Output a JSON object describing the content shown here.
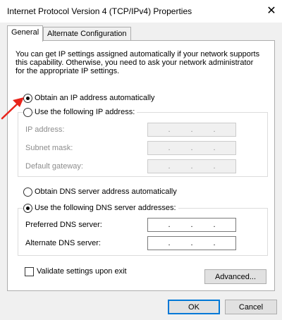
{
  "window": {
    "title": "Internet Protocol Version 4 (TCP/IPv4) Properties",
    "close_glyph": "✕"
  },
  "tabs": [
    {
      "label": "General",
      "active": true
    },
    {
      "label": "Alternate Configuration",
      "active": false
    }
  ],
  "description": "You can get IP settings assigned automatically if your network supports this capability. Otherwise, you need to ask your network administrator for the appropriate IP settings.",
  "ip_section": {
    "auto_label": "Obtain an IP address automatically",
    "auto_selected": true,
    "manual_label": "Use the following IP address:",
    "manual_selected": false,
    "fields": [
      {
        "label": "IP address:",
        "value": "",
        "enabled": false
      },
      {
        "label": "Subnet mask:",
        "value": "",
        "enabled": false
      },
      {
        "label": "Default gateway:",
        "value": "",
        "enabled": false
      }
    ]
  },
  "dns_section": {
    "auto_label": "Obtain DNS server address automatically",
    "auto_selected": false,
    "manual_label": "Use the following DNS server addresses:",
    "manual_selected": true,
    "fields": [
      {
        "label": "Preferred DNS server:",
        "value": "",
        "enabled": true
      },
      {
        "label": "Alternate DNS server:",
        "value": "",
        "enabled": true
      }
    ]
  },
  "validate": {
    "label": "Validate settings upon exit",
    "checked": false
  },
  "buttons": {
    "advanced": "Advanced...",
    "ok": "OK",
    "cancel": "Cancel"
  },
  "colors": {
    "accent": "#0078d7",
    "annotation_arrow": "#e8241b"
  },
  "ip_separator": "."
}
